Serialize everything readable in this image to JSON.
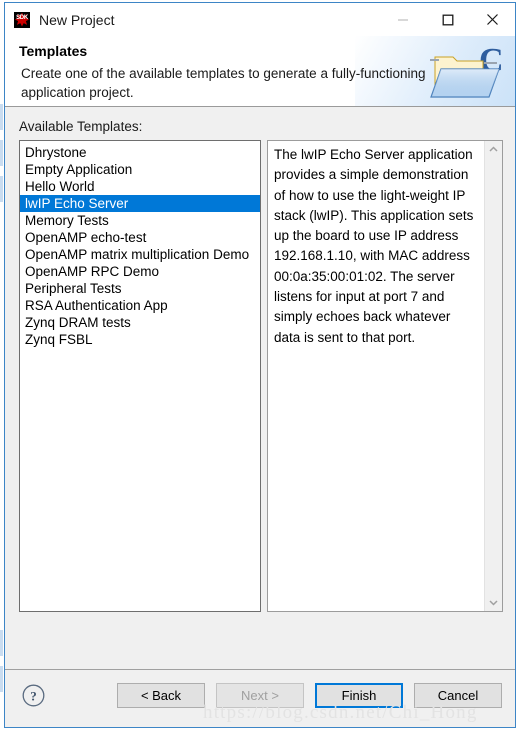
{
  "window": {
    "title": "New Project",
    "app_icon": "sdk-icon",
    "icon_label": "SDK",
    "controls": {
      "minimize": "minimize-icon",
      "maximize": "maximize-icon",
      "close": "close-icon"
    }
  },
  "header": {
    "title": "Templates",
    "description": "Create one of the available templates to generate a fully-functioning application project.",
    "icon": "folder-c-icon"
  },
  "body": {
    "available_label": "Available Templates:",
    "templates": [
      {
        "label": "Dhrystone",
        "selected": false
      },
      {
        "label": "Empty Application",
        "selected": false
      },
      {
        "label": "Hello World",
        "selected": false
      },
      {
        "label": "lwIP Echo Server",
        "selected": true
      },
      {
        "label": "Memory Tests",
        "selected": false
      },
      {
        "label": "OpenAMP echo-test",
        "selected": false
      },
      {
        "label": "OpenAMP matrix multiplication Demo",
        "selected": false
      },
      {
        "label": "OpenAMP RPC Demo",
        "selected": false
      },
      {
        "label": "Peripheral Tests",
        "selected": false
      },
      {
        "label": "RSA Authentication App",
        "selected": false
      },
      {
        "label": "Zynq DRAM tests",
        "selected": false
      },
      {
        "label": "Zynq FSBL",
        "selected": false
      }
    ],
    "description_text": "The lwIP Echo Server application provides a simple demonstration of how to use the light-weight IP stack (lwIP). This application sets up the board to use IP address 192.168.1.10, with MAC address 00:0a:35:00:01:02. The server listens for input at port 7 and simply echoes back whatever data is sent to that port.",
    "scrollbar": {
      "up_arrow": "chevron-up-icon",
      "down_arrow": "chevron-down-icon"
    }
  },
  "footer": {
    "help": "help-icon",
    "buttons": [
      {
        "label": "< Back",
        "state": "enabled"
      },
      {
        "label": "Next >",
        "state": "disabled"
      },
      {
        "label": "Finish",
        "state": "default"
      },
      {
        "label": "Cancel",
        "state": "enabled"
      }
    ]
  },
  "watermark": "https://blog.csdn.net/Chi_Hong",
  "colors": {
    "selection": "#0078d7",
    "dialog_border": "#3d85c6",
    "face": "#f0f0f0"
  }
}
